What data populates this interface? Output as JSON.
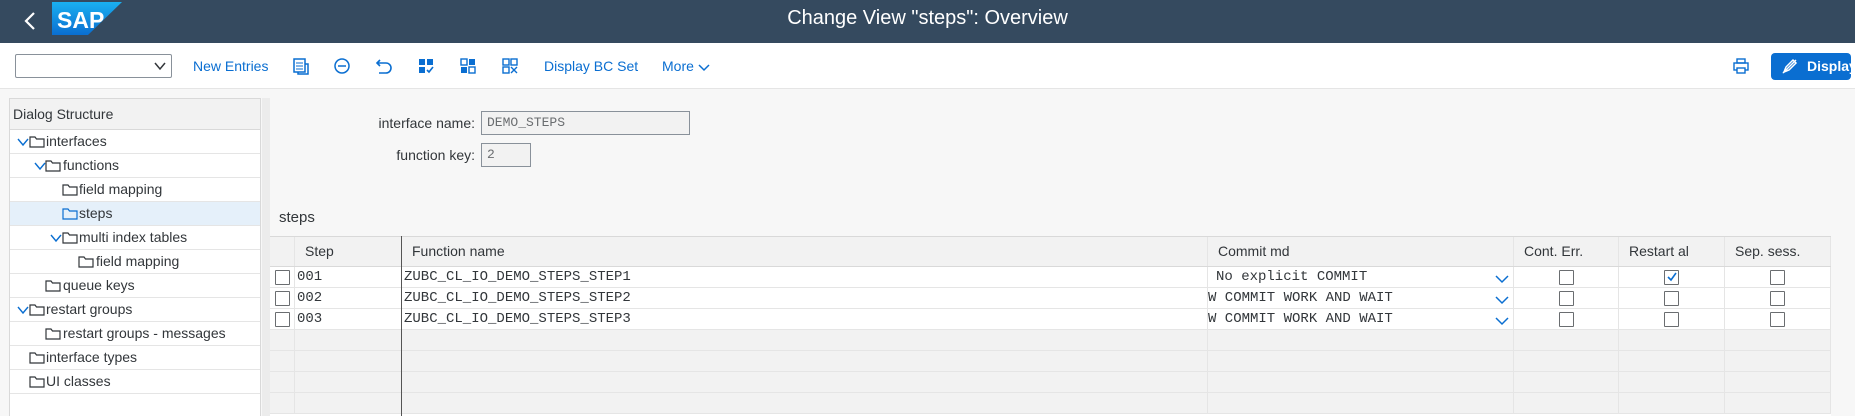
{
  "header": {
    "title": "Change View \"steps\": Overview",
    "logo_text": "SAP"
  },
  "toolbar": {
    "dropdown_value": "",
    "new_entries": "New Entries",
    "display_bc_set": "Display BC Set",
    "more": "More",
    "display": "Display"
  },
  "tree": {
    "header": "Dialog Structure",
    "items": [
      {
        "label": "interfaces"
      },
      {
        "label": "functions"
      },
      {
        "label": "field mapping"
      },
      {
        "label": "steps"
      },
      {
        "label": "multi index tables"
      },
      {
        "label": "field mapping"
      },
      {
        "label": "queue keys"
      },
      {
        "label": "restart groups"
      },
      {
        "label": "restart groups - messages"
      },
      {
        "label": "interface types"
      },
      {
        "label": "UI classes"
      }
    ]
  },
  "form": {
    "interface_name_label": "interface name:",
    "interface_name_value": "DEMO_STEPS",
    "function_key_label": "function key:",
    "function_key_value": "2"
  },
  "section": {
    "title": "steps"
  },
  "table": {
    "columns": [
      "Step",
      "Function name",
      "Commit md",
      "Cont. Err.",
      "Restart al",
      "Sep. sess."
    ],
    "rows": [
      {
        "step": "001",
        "function": "ZUBC_CL_IO_DEMO_STEPS_STEP1",
        "commit": "No explicit COMMIT",
        "cont_err": false,
        "restart": true,
        "sep_sess": false
      },
      {
        "step": "002",
        "function": "ZUBC_CL_IO_DEMO_STEPS_STEP2",
        "commit": "W COMMIT WORK AND WAIT",
        "cont_err": false,
        "restart": false,
        "sep_sess": false
      },
      {
        "step": "003",
        "function": "ZUBC_CL_IO_DEMO_STEPS_STEP3",
        "commit": "W COMMIT WORK AND WAIT",
        "cont_err": false,
        "restart": false,
        "sep_sess": false
      }
    ]
  },
  "colors": {
    "shell": "#354a5f",
    "accent": "#0a6ed1",
    "selected_row": "#e5f0fa"
  }
}
